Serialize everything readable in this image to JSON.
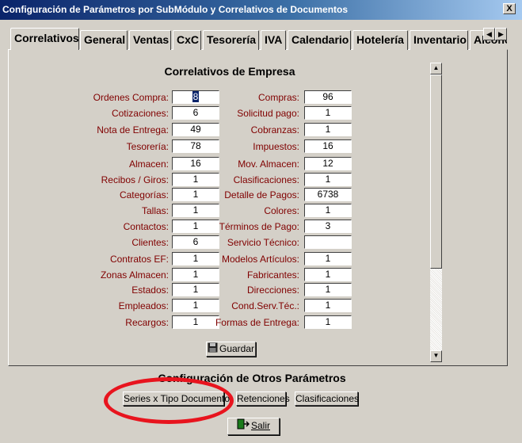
{
  "window": {
    "title": "Configuración de Parámetros por SubMódulo y Correlativos de Documentos",
    "close_label": "X"
  },
  "tabs": [
    "Correlativos",
    "General",
    "Ventas",
    "CxC",
    "Tesorería",
    "IVA",
    "Calendario",
    "Hotelería",
    "Inventario",
    "Alcoho"
  ],
  "tab_scroll": {
    "left": "◀",
    "right": "▶"
  },
  "section_title": "Correlativos de Empresa",
  "left_fields": [
    {
      "label": "Ordenes Compra:",
      "value": "8"
    },
    {
      "label": "Cotizaciones:",
      "value": "6"
    },
    {
      "label": "Nota de Entrega:",
      "value": "49"
    },
    {
      "label": "Tesorería:",
      "value": "78"
    },
    {
      "label": "Almacen:",
      "value": "16"
    },
    {
      "label": "Recibos / Giros:",
      "value": "1"
    },
    {
      "label": "Categorías:",
      "value": "1"
    },
    {
      "label": "Tallas:",
      "value": "1"
    },
    {
      "label": "Contactos:",
      "value": "1"
    },
    {
      "label": "Clientes:",
      "value": "6"
    },
    {
      "label": "Contratos EF:",
      "value": "1"
    },
    {
      "label": "Zonas Almacen:",
      "value": "1"
    },
    {
      "label": "Estados:",
      "value": "1"
    },
    {
      "label": "Empleados:",
      "value": "1"
    },
    {
      "label": "Recargos:",
      "value": "1"
    }
  ],
  "right_fields": [
    {
      "label": "Compras:",
      "value": "96"
    },
    {
      "label": "Solicitud pago:",
      "value": "1"
    },
    {
      "label": "Cobranzas:",
      "value": "1"
    },
    {
      "label": "Impuestos:",
      "value": "16"
    },
    {
      "label": "Mov. Almacen:",
      "value": "12"
    },
    {
      "label": "Clasificaciones:",
      "value": "1"
    },
    {
      "label": "Detalle de Pagos:",
      "value": "6738"
    },
    {
      "label": "Colores:",
      "value": "1"
    },
    {
      "label": "Términos de Pago:",
      "value": "3"
    },
    {
      "label": "Servicio Técnico:",
      "value": ""
    },
    {
      "label": "Modelos Artículos:",
      "value": "1"
    },
    {
      "label": "Fabricantes:",
      "value": "1"
    },
    {
      "label": "Direcciones:",
      "value": "1"
    },
    {
      "label": "Cond.Serv.Téc.:",
      "value": "1"
    },
    {
      "label": "Formas de Entrega:",
      "value": "1"
    }
  ],
  "scrollbar": {
    "up": "▲",
    "down": "▼"
  },
  "buttons": {
    "guardar": "Guardar",
    "series": "Series x Tipo Documento",
    "retenciones": "Retenciones",
    "clasificaciones": "Clasificaciones",
    "salir": "Salir"
  },
  "other_title": "Configuración de Otros Parámetros",
  "colors": {
    "label": "#800000",
    "title_bar": "#0a246a",
    "highlight_circle": "#e8141e"
  }
}
